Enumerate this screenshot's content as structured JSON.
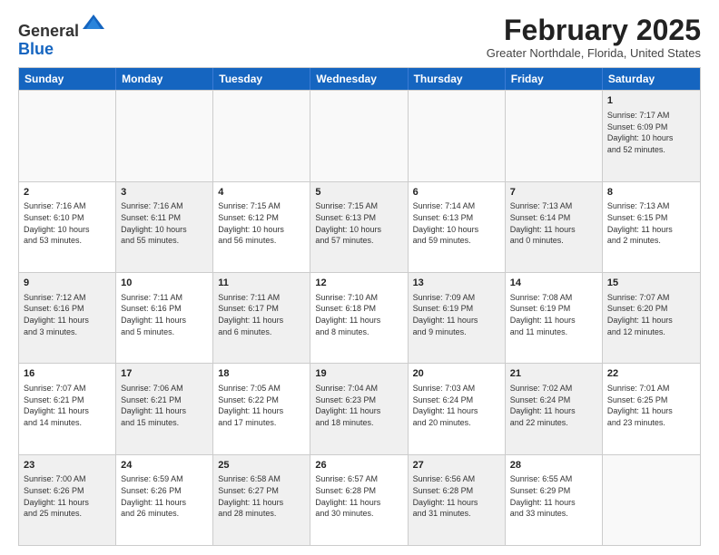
{
  "header": {
    "logo": {
      "line1": "General",
      "line2": "Blue"
    },
    "title": "February 2025",
    "location": "Greater Northdale, Florida, United States"
  },
  "calendar": {
    "weekdays": [
      "Sunday",
      "Monday",
      "Tuesday",
      "Wednesday",
      "Thursday",
      "Friday",
      "Saturday"
    ],
    "rows": [
      [
        {
          "day": "",
          "info": "",
          "empty": true
        },
        {
          "day": "",
          "info": "",
          "empty": true
        },
        {
          "day": "",
          "info": "",
          "empty": true
        },
        {
          "day": "",
          "info": "",
          "empty": true
        },
        {
          "day": "",
          "info": "",
          "empty": true
        },
        {
          "day": "",
          "info": "",
          "empty": true
        },
        {
          "day": "1",
          "info": "Sunrise: 7:17 AM\nSunset: 6:09 PM\nDaylight: 10 hours\nand 52 minutes.",
          "shaded": true
        }
      ],
      [
        {
          "day": "2",
          "info": "Sunrise: 7:16 AM\nSunset: 6:10 PM\nDaylight: 10 hours\nand 53 minutes."
        },
        {
          "day": "3",
          "info": "Sunrise: 7:16 AM\nSunset: 6:11 PM\nDaylight: 10 hours\nand 55 minutes.",
          "shaded": true
        },
        {
          "day": "4",
          "info": "Sunrise: 7:15 AM\nSunset: 6:12 PM\nDaylight: 10 hours\nand 56 minutes."
        },
        {
          "day": "5",
          "info": "Sunrise: 7:15 AM\nSunset: 6:13 PM\nDaylight: 10 hours\nand 57 minutes.",
          "shaded": true
        },
        {
          "day": "6",
          "info": "Sunrise: 7:14 AM\nSunset: 6:13 PM\nDaylight: 10 hours\nand 59 minutes."
        },
        {
          "day": "7",
          "info": "Sunrise: 7:13 AM\nSunset: 6:14 PM\nDaylight: 11 hours\nand 0 minutes.",
          "shaded": true
        },
        {
          "day": "8",
          "info": "Sunrise: 7:13 AM\nSunset: 6:15 PM\nDaylight: 11 hours\nand 2 minutes."
        }
      ],
      [
        {
          "day": "9",
          "info": "Sunrise: 7:12 AM\nSunset: 6:16 PM\nDaylight: 11 hours\nand 3 minutes.",
          "shaded": true
        },
        {
          "day": "10",
          "info": "Sunrise: 7:11 AM\nSunset: 6:16 PM\nDaylight: 11 hours\nand 5 minutes."
        },
        {
          "day": "11",
          "info": "Sunrise: 7:11 AM\nSunset: 6:17 PM\nDaylight: 11 hours\nand 6 minutes.",
          "shaded": true
        },
        {
          "day": "12",
          "info": "Sunrise: 7:10 AM\nSunset: 6:18 PM\nDaylight: 11 hours\nand 8 minutes."
        },
        {
          "day": "13",
          "info": "Sunrise: 7:09 AM\nSunset: 6:19 PM\nDaylight: 11 hours\nand 9 minutes.",
          "shaded": true
        },
        {
          "day": "14",
          "info": "Sunrise: 7:08 AM\nSunset: 6:19 PM\nDaylight: 11 hours\nand 11 minutes."
        },
        {
          "day": "15",
          "info": "Sunrise: 7:07 AM\nSunset: 6:20 PM\nDaylight: 11 hours\nand 12 minutes.",
          "shaded": true
        }
      ],
      [
        {
          "day": "16",
          "info": "Sunrise: 7:07 AM\nSunset: 6:21 PM\nDaylight: 11 hours\nand 14 minutes."
        },
        {
          "day": "17",
          "info": "Sunrise: 7:06 AM\nSunset: 6:21 PM\nDaylight: 11 hours\nand 15 minutes.",
          "shaded": true
        },
        {
          "day": "18",
          "info": "Sunrise: 7:05 AM\nSunset: 6:22 PM\nDaylight: 11 hours\nand 17 minutes."
        },
        {
          "day": "19",
          "info": "Sunrise: 7:04 AM\nSunset: 6:23 PM\nDaylight: 11 hours\nand 18 minutes.",
          "shaded": true
        },
        {
          "day": "20",
          "info": "Sunrise: 7:03 AM\nSunset: 6:24 PM\nDaylight: 11 hours\nand 20 minutes."
        },
        {
          "day": "21",
          "info": "Sunrise: 7:02 AM\nSunset: 6:24 PM\nDaylight: 11 hours\nand 22 minutes.",
          "shaded": true
        },
        {
          "day": "22",
          "info": "Sunrise: 7:01 AM\nSunset: 6:25 PM\nDaylight: 11 hours\nand 23 minutes."
        }
      ],
      [
        {
          "day": "23",
          "info": "Sunrise: 7:00 AM\nSunset: 6:26 PM\nDaylight: 11 hours\nand 25 minutes.",
          "shaded": true
        },
        {
          "day": "24",
          "info": "Sunrise: 6:59 AM\nSunset: 6:26 PM\nDaylight: 11 hours\nand 26 minutes."
        },
        {
          "day": "25",
          "info": "Sunrise: 6:58 AM\nSunset: 6:27 PM\nDaylight: 11 hours\nand 28 minutes.",
          "shaded": true
        },
        {
          "day": "26",
          "info": "Sunrise: 6:57 AM\nSunset: 6:28 PM\nDaylight: 11 hours\nand 30 minutes."
        },
        {
          "day": "27",
          "info": "Sunrise: 6:56 AM\nSunset: 6:28 PM\nDaylight: 11 hours\nand 31 minutes.",
          "shaded": true
        },
        {
          "day": "28",
          "info": "Sunrise: 6:55 AM\nSunset: 6:29 PM\nDaylight: 11 hours\nand 33 minutes."
        },
        {
          "day": "",
          "info": "",
          "empty": true
        }
      ]
    ]
  }
}
